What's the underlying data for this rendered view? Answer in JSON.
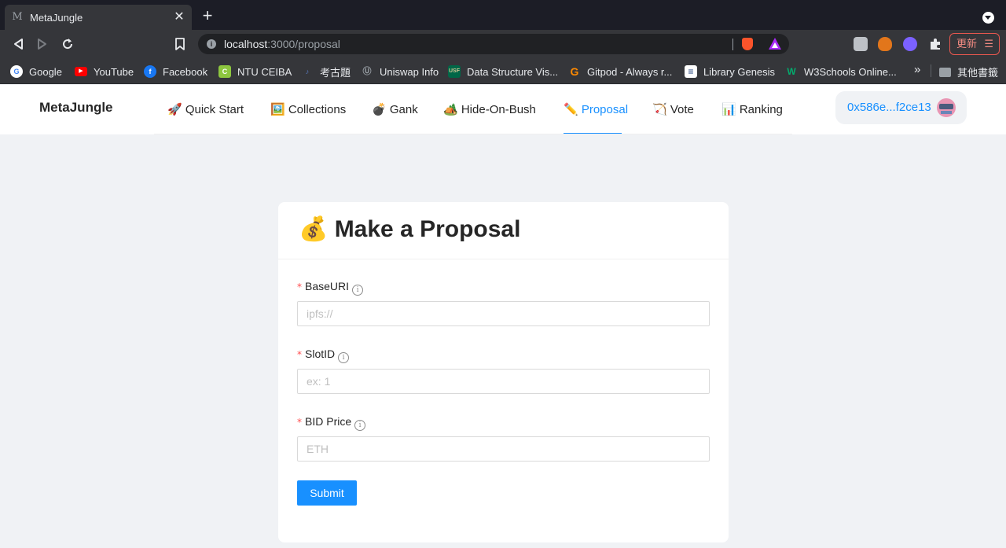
{
  "browser": {
    "tab_favicon": "M",
    "tab_title": "MetaJungle",
    "tab_close": "✕",
    "new_tab": "+",
    "url_host": "localhost",
    "url_path": ":3000/proposal",
    "update_label": "更新",
    "update_menu": "☰",
    "bookmarks_more": "»",
    "bookmarks": [
      {
        "label": "Google",
        "icon": "G",
        "color": "#ffffff"
      },
      {
        "label": "YouTube",
        "icon": "▶",
        "color": "#ff0000"
      },
      {
        "label": "Facebook",
        "icon": "f",
        "color": "#1877f2"
      },
      {
        "label": "NTU CEIBA",
        "icon": "C",
        "color": "#8dc63f"
      },
      {
        "label": "考古題",
        "icon": "♪",
        "color": "#3b5998"
      },
      {
        "label": "Uniswap Info",
        "icon": "Ⓤ",
        "color": "#35363a"
      },
      {
        "label": "Data Structure Vis...",
        "icon": "USF",
        "color": "#006747"
      },
      {
        "label": "Gitpod - Always r...",
        "icon": "G",
        "color": "#ff8a00"
      },
      {
        "label": "Library Genesis",
        "icon": "≡",
        "color": "#ffffff"
      },
      {
        "label": "W3Schools Online...",
        "icon": "W",
        "color": "#04aa6d"
      }
    ],
    "other_bookmarks": "其他書籤"
  },
  "site": {
    "logo": "MetaJungle",
    "nav": [
      {
        "label": "🚀 Quick Start",
        "active": false
      },
      {
        "label": "🖼️ Collections",
        "active": false
      },
      {
        "label": "💣 Gank",
        "active": false
      },
      {
        "label": "🏕️ Hide-On-Bush",
        "active": false
      },
      {
        "label": "✏️ Proposal",
        "active": true
      },
      {
        "label": "🏹 Vote",
        "active": false
      },
      {
        "label": "📊 Ranking",
        "active": false
      }
    ],
    "wallet_address": "0x586e...f2ce13"
  },
  "form": {
    "title": "💰 Make a Proposal",
    "required_mark": "*",
    "info_glyph": "i",
    "fields": [
      {
        "label": "BaseURI",
        "placeholder": "ipfs://",
        "value": ""
      },
      {
        "label": "SlotID",
        "placeholder": "ex: 1",
        "value": ""
      },
      {
        "label": "BID Price",
        "placeholder": "ETH",
        "value": ""
      }
    ],
    "submit_label": "Submit"
  },
  "colors": {
    "accent": "#1890ff",
    "required": "#ff4d4f",
    "page_background": "#f0f2f5"
  }
}
